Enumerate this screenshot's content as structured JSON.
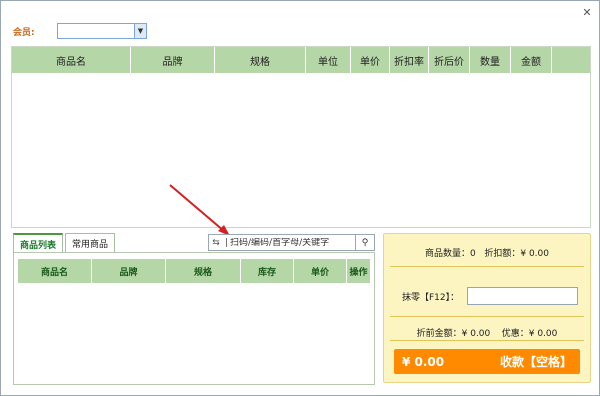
{
  "window": {
    "close_glyph": "✕"
  },
  "member": {
    "label": "会员:"
  },
  "main_table": {
    "headers": [
      "商品名",
      "品牌",
      "规格",
      "单位",
      "单价",
      "折扣率",
      "折后价",
      "数量",
      "金额"
    ]
  },
  "tabs": [
    "商品列表",
    "常用商品"
  ],
  "search": {
    "placeholder": "扫码/编码/首字母/关键字"
  },
  "list_table": {
    "headers": [
      "商品名",
      "品牌",
      "规格",
      "库存",
      "单价",
      "操作"
    ]
  },
  "summary": {
    "qty_label": "商品数量：",
    "qty_value": "0",
    "discount_label": "折扣额：",
    "discount_value": "¥ 0.00",
    "round_label": "抹零【F12】：",
    "pre_label": "折前金额：",
    "pre_value": "¥ 0.00",
    "benefit_label": "优惠：",
    "benefit_value": "¥ 0.00"
  },
  "pay_button": {
    "amount": "¥ 0.00",
    "label": "收款【空格】"
  },
  "colors": {
    "header_green": "#b5d6a7",
    "pay_orange": "#ff8a00",
    "summary_yellow": "#fdf5c1"
  }
}
